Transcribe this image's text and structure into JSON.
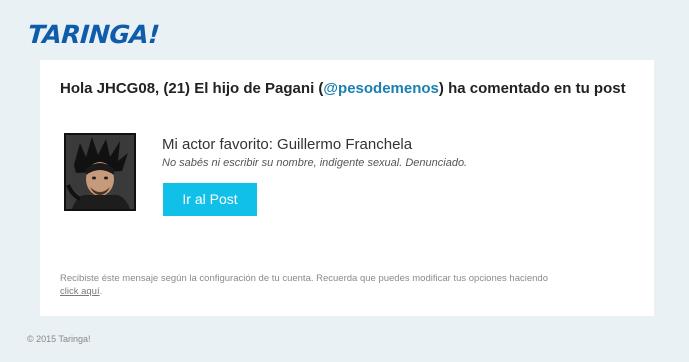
{
  "brand": {
    "logo_text": "TARINGA!"
  },
  "email": {
    "headline_prefix": "Hola JHCG08, (21) El hijo de Pagani (",
    "mention": "@pesodemenos",
    "headline_suffix": ") ha comentado en tu post",
    "comment_title": "Mi actor favorito: Guillermo Franchela",
    "comment_text": "No sabés ni escribir su nombre, indigente sexual. Denunciado.",
    "button_label": "Ir al Post",
    "notice_text": "Recibiste éste mensaje según la configuración de tu cuenta. Recuerda que puedes modificar tus opciones haciendo",
    "notice_link": "click aquí",
    "notice_end": "."
  },
  "footer": {
    "copyright": "© 2015 Taringa!"
  },
  "colors": {
    "background": "#e9f1f5",
    "brand": "#0f5cab",
    "mention": "#1b7fb2",
    "button": "#10c0e8"
  },
  "icons": {
    "avatar": "user-avatar-image"
  }
}
